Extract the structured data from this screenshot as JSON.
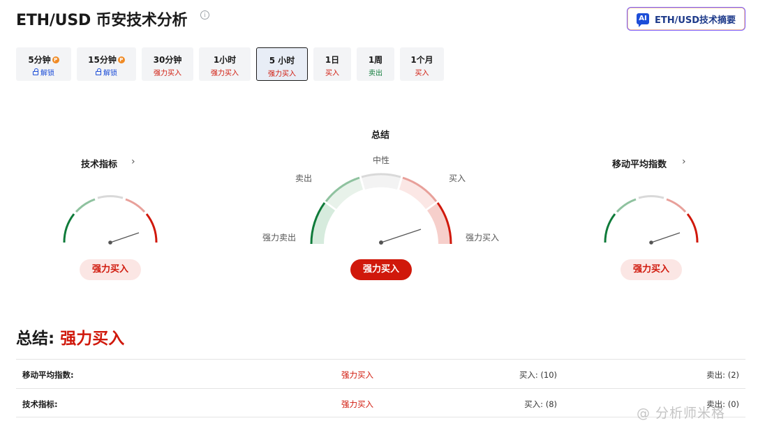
{
  "header": {
    "title": "ETH/USD 币安技术分析",
    "ai_button_label": "ETH/USD技术摘要",
    "ai_icon_text": "AI"
  },
  "timeframes": [
    {
      "label": "5分钟",
      "sub": "解锁",
      "pro": true,
      "locked": true,
      "tone": "blue"
    },
    {
      "label": "15分钟",
      "sub": "解锁",
      "pro": true,
      "locked": true,
      "tone": "blue"
    },
    {
      "label": "30分钟",
      "sub": "强力买入",
      "tone": "red"
    },
    {
      "label": "1小时",
      "sub": "强力买入",
      "tone": "red"
    },
    {
      "label": "5 小时",
      "sub": "强力买入",
      "tone": "red",
      "active": true
    },
    {
      "label": "1日",
      "sub": "买入",
      "tone": "red"
    },
    {
      "label": "1周",
      "sub": "卖出",
      "tone": "green"
    },
    {
      "label": "1个月",
      "sub": "买入",
      "tone": "red"
    }
  ],
  "gauges": {
    "technical": {
      "title": "技术指标",
      "result": "强力买入"
    },
    "summary": {
      "title": "总结",
      "result": "强力买入",
      "labels": {
        "neutral": "中性",
        "sell": "卖出",
        "buy": "买入",
        "strong_sell": "强力卖出",
        "strong_buy": "强力买入"
      }
    },
    "moving_averages": {
      "title": "移动平均指数",
      "result": "强力买入"
    }
  },
  "summary": {
    "label": "总结:",
    "value": "强力买入"
  },
  "table": [
    {
      "name": "移动平均指数:",
      "verdict": "强力买入",
      "buy": "买入: (10)",
      "sell": "卖出: (2)"
    },
    {
      "name": "技术指标:",
      "verdict": "强力买入",
      "buy": "买入: (8)",
      "sell": "卖出: (0)"
    }
  ],
  "watermark": "@ 分析师米格",
  "colors": {
    "strong_buy": "#d0180b",
    "buy": "#e8a09a",
    "neutral": "#d9d9d9",
    "sell": "#8fc29f",
    "strong_sell": "#0f7b3a"
  }
}
